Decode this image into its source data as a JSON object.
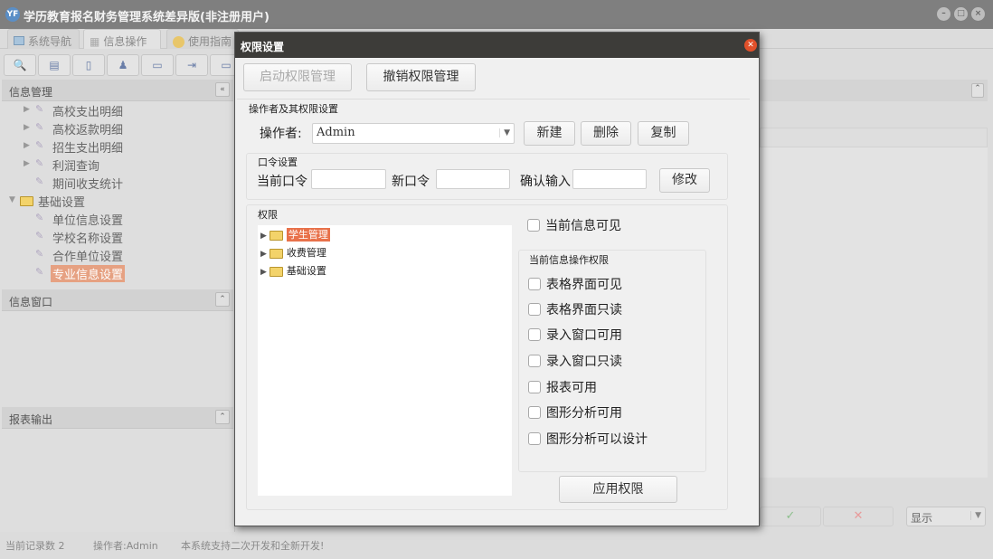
{
  "window": {
    "logo": "YF",
    "title": "学历教育报名财务管理系统差异版(非注册用户)",
    "min": "–",
    "max": "□",
    "close": "×"
  },
  "tabs": [
    {
      "label": "系统导航",
      "icon": "monitor-icon"
    },
    {
      "label": "信息操作",
      "icon": "grid-icon"
    },
    {
      "label": "使用指南",
      "icon": "help-globe-icon"
    }
  ],
  "toolbar_icons": [
    "search-doc-icon",
    "list-icon",
    "document-icon",
    "user-computer-icon",
    "monitor-globe-icon",
    "export-icon",
    "window-icon"
  ],
  "left": {
    "panel1": {
      "title": "信息管理",
      "collapse": "«",
      "tree": [
        {
          "label": "高校支出明细",
          "expandable": true
        },
        {
          "label": "高校返款明细",
          "expandable": true
        },
        {
          "label": "招生支出明细",
          "expandable": true
        },
        {
          "label": "利润查询",
          "expandable": true
        },
        {
          "label": "期间收支统计",
          "expandable": false
        }
      ],
      "folder": {
        "label": "基础设置",
        "children": [
          "单位信息设置",
          "学校名称设置",
          "合作单位设置",
          "专业信息设置"
        ],
        "selected": "专业信息设置"
      }
    },
    "panel2": {
      "title": "信息窗口"
    },
    "panel3": {
      "title": "报表输出"
    }
  },
  "right": {
    "confirm_icon": "✓",
    "cancel_icon": "✕",
    "select_value": "显示"
  },
  "status": {
    "records": "当前记录数 2",
    "operator": "操作者:Admin",
    "message": "本系统支持二次开发和全新开发!"
  },
  "dialog": {
    "title": "权限设置",
    "enable_btn": "启动权限管理",
    "revoke_btn": "撤销权限管理",
    "operator_group": "操作者及其权限设置",
    "operator_label": "操作者:",
    "operator_value": "Admin",
    "new_btn": "新建",
    "delete_btn": "删除",
    "copy_btn": "复制",
    "pwd_group": "口令设置",
    "cur_pwd": "当前口令",
    "new_pwd": "新口令",
    "confirm_pwd": "确认输入",
    "modify_btn": "修改",
    "perm_group": "权限",
    "perm_tree": [
      "学生管理",
      "收费管理",
      "基础设置"
    ],
    "perm_selected": "学生管理",
    "visible_cb": "当前信息可见",
    "op_group": "当前信息操作权限",
    "op_checks": [
      "表格界面可见",
      "表格界面只读",
      "录入窗口可用",
      "录入窗口只读",
      "报表可用",
      "图形分析可用",
      "图形分析可以设计"
    ],
    "apply_btn": "应用权限"
  }
}
